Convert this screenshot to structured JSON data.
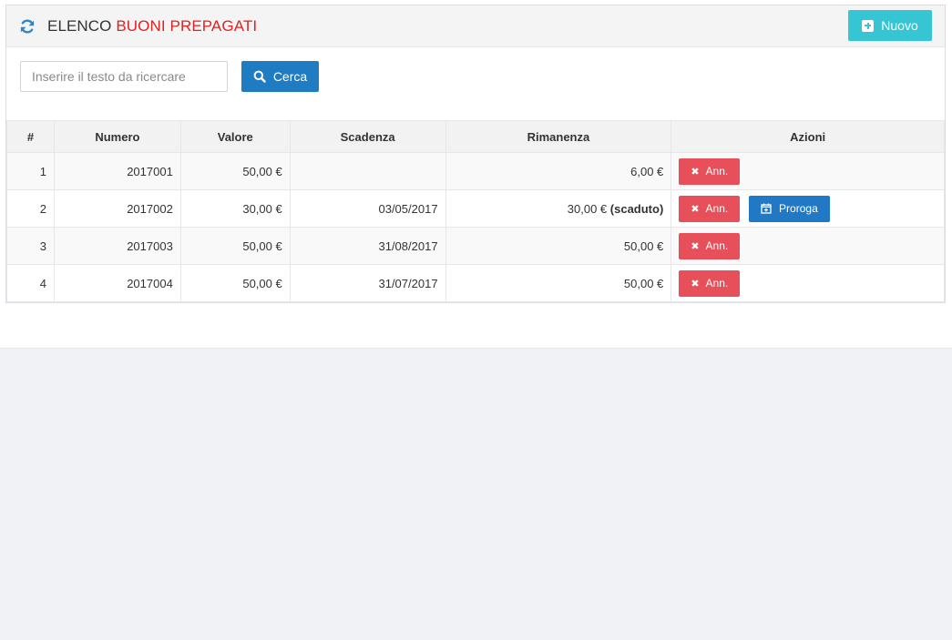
{
  "header": {
    "title_part1": "ELENCO",
    "title_part2": "BUONI PREPAGATI",
    "new_button_label": "Nuovo"
  },
  "search": {
    "placeholder": "Inserire il testo da ricercare",
    "value": "",
    "button_label": "Cerca"
  },
  "table": {
    "columns": [
      "#",
      "Numero",
      "Valore",
      "Scadenza",
      "Rimanenza",
      "Azioni"
    ],
    "rows": [
      {
        "index": "1",
        "numero": "2017001",
        "valore": "50,00 €",
        "scadenza": "",
        "rimanenza": "6,00 €",
        "rimanenza_note": "",
        "actions": [
          "Ann."
        ]
      },
      {
        "index": "2",
        "numero": "2017002",
        "valore": "30,00 €",
        "scadenza": "03/05/2017",
        "rimanenza": "30,00 €",
        "rimanenza_note": "(scaduto)",
        "actions": [
          "Ann.",
          "Proroga"
        ]
      },
      {
        "index": "3",
        "numero": "2017003",
        "valore": "50,00 €",
        "scadenza": "31/08/2017",
        "rimanenza": "50,00 €",
        "rimanenza_note": "",
        "actions": [
          "Ann."
        ]
      },
      {
        "index": "4",
        "numero": "2017004",
        "valore": "50,00 €",
        "scadenza": "31/07/2017",
        "rimanenza": "50,00 €",
        "rimanenza_note": "",
        "actions": [
          "Ann."
        ]
      }
    ]
  },
  "icons": {
    "refresh": "refresh-icon",
    "new": "plus-square-icon",
    "search": "search-icon",
    "cancel": "close-icon",
    "extend": "calendar-plus-icon"
  },
  "colors": {
    "title_accent": "#e02222",
    "new_button": "#36c6d3",
    "primary_button": "#1f7cc2",
    "danger_button": "#e7505a"
  }
}
